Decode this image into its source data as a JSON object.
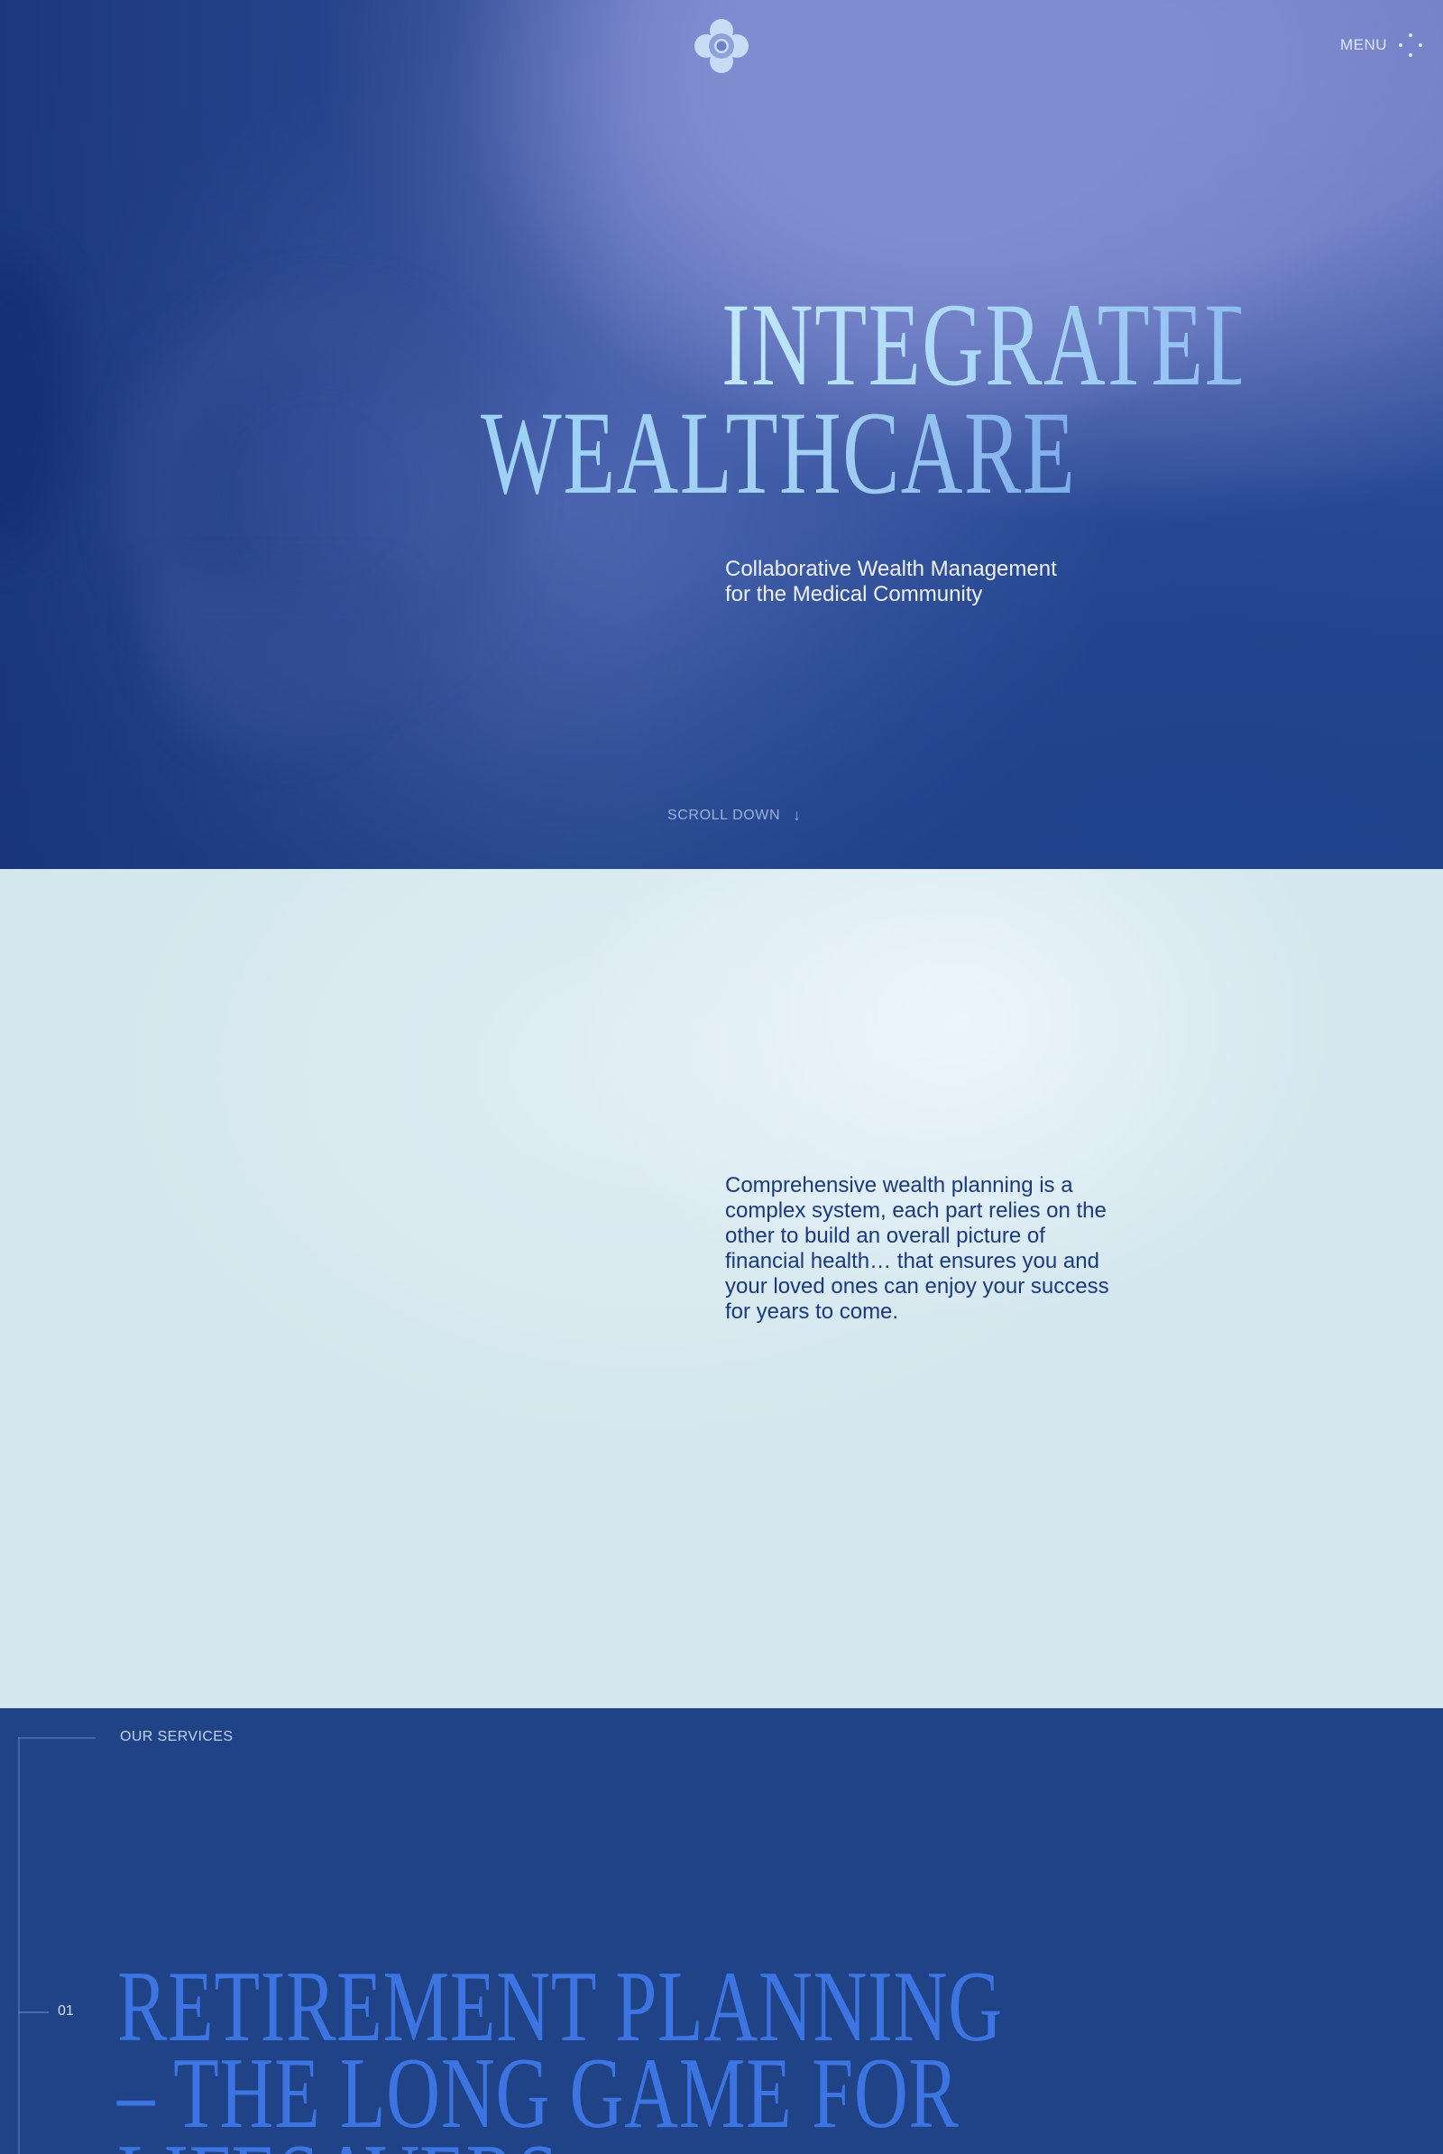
{
  "header": {
    "logo_icon": "flower-logo-icon",
    "menu_label": "MENU",
    "menu_icon": "dots-menu-icon"
  },
  "hero": {
    "title_line1": "INTEGRATED",
    "title_line2": "WEALTHCARE",
    "subtitle_line1": "Collaborative Wealth Management",
    "subtitle_line2": "for the Medical Community",
    "scroll_label": "SCROLL DOWN",
    "scroll_icon": "arrow-down-icon",
    "scroll_arrow": "↓"
  },
  "intro": {
    "text": "Comprehensive wealth planning is a complex system, each part relies on the other to build an overall picture of financial health… that ensures you and your loved ones can enjoy your success for years to come."
  },
  "services": {
    "label": "OUR SERVICES",
    "items": [
      {
        "number": "01",
        "title_line1": "RETIREMENT PLANNING",
        "title_line2": "– THE LONG GAME FOR",
        "title_line3": "LIFESAVERS"
      }
    ]
  },
  "colors": {
    "hero_dark_blue": "#214389",
    "hero_lavender": "#808cd0",
    "title_light_blue": "#a9d8f6",
    "intro_background": "#d4e7ee",
    "intro_text": "#1a3a7e",
    "services_background": "#204287",
    "service_title_blue": "#3c74e2"
  }
}
